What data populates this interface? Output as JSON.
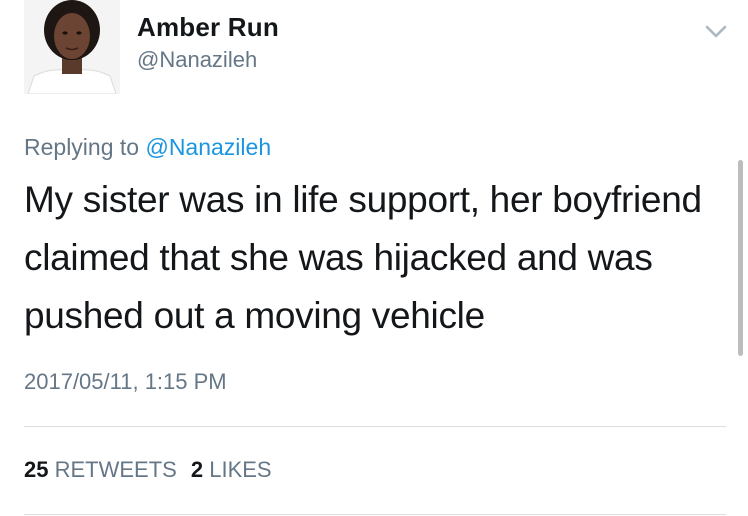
{
  "author": {
    "display_name": "Amber Run",
    "handle": "@Nanazileh"
  },
  "reply": {
    "prefix": "Replying to",
    "mention": "@Nanazileh"
  },
  "tweet": {
    "text": "My sister was in life support, her boyfriend claimed that she was hijacked and was pushed out a moving vehicle",
    "timestamp": "2017/05/11, 1:15 PM"
  },
  "stats": {
    "retweets_count": "25",
    "retweets_label": "RETWEETS",
    "likes_count": "2",
    "likes_label": "LIKES"
  },
  "icons": {
    "caret": "chevron-down-icon"
  },
  "colors": {
    "text_primary": "#14171a",
    "text_secondary": "#657786",
    "link": "#1b95e0",
    "divider": "#d8dee2"
  }
}
